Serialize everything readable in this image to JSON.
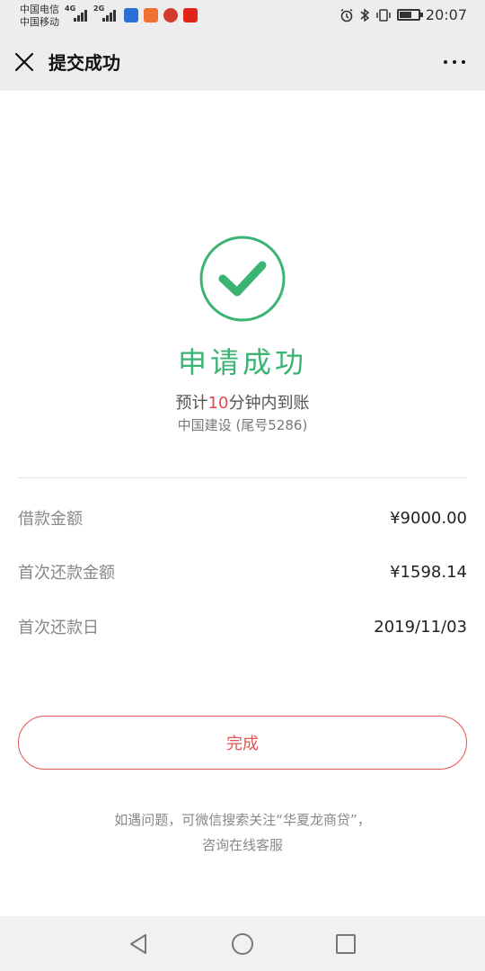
{
  "status_bar": {
    "carrier_1": "中国电信",
    "carrier_2": "中国移动",
    "net_1": "4G",
    "net_2": "2G",
    "time": "20:07"
  },
  "title_bar": {
    "title": "提交成功",
    "close_icon": "close-icon",
    "more_icon": "more-icon"
  },
  "result": {
    "icon": "check-circle-icon",
    "title": "申请成功",
    "eta_prefix": "预计",
    "eta_number": "10",
    "eta_suffix": "分钟内到账",
    "bank": "中国建设 (尾号5286)"
  },
  "details": [
    {
      "label": "借款金额",
      "value": "¥9000.00"
    },
    {
      "label": "首次还款金额",
      "value": "¥1598.14"
    },
    {
      "label": "首次还款日",
      "value": "2019/11/03"
    }
  ],
  "actions": {
    "done_label": "完成"
  },
  "help": {
    "line1": "如遇问题，可微信搜索关注“华夏龙商贷”，",
    "line2": "咨询在线客服"
  },
  "colors": {
    "success": "#3bb372",
    "accent": "#e25454",
    "header_bg": "#ededed"
  }
}
